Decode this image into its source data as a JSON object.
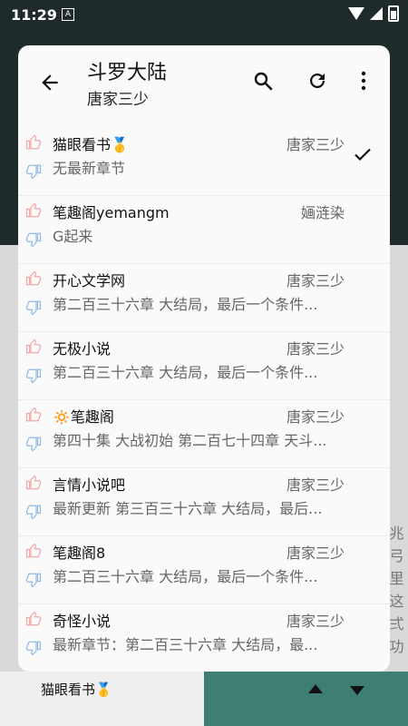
{
  "status_bar": {
    "time": "11:29",
    "notification": "A"
  },
  "header": {
    "title": "斗罗大陆",
    "subtitle": "唐家三少",
    "icons": {
      "back": "back-arrow-icon",
      "search": "search-icon",
      "refresh": "refresh-icon",
      "more": "more-vert-icon"
    }
  },
  "sources": [
    {
      "name": "猫眼看书🥇",
      "author": "唐家三少",
      "latest": "无最新章节",
      "selected": true
    },
    {
      "name": "笔趣阁yemangm",
      "author": "婳涟染",
      "latest": "G起来",
      "selected": false
    },
    {
      "name": "开心文学网",
      "author": "唐家三少",
      "latest": "第二百三十六章 大结局，最后一个条件...",
      "selected": false
    },
    {
      "name": "无极小说",
      "author": "唐家三少",
      "latest": "第二百三十六章 大结局，最后一个条件...",
      "selected": false
    },
    {
      "name": "🔅笔趣阁",
      "author": "唐家三少",
      "latest": "第四十集 大战初始 第二百七十四章 天斗...",
      "selected": false
    },
    {
      "name": "言情小说吧",
      "author": "唐家三少",
      "latest": "最新更新 第三百三十六章 大结局，最后...",
      "selected": false
    },
    {
      "name": "笔趣阁8",
      "author": "唐家三少",
      "latest": "第二百三十六章 大结局，最后一个条件...",
      "selected": false
    },
    {
      "name": "奇怪小说",
      "author": "唐家三少",
      "latest": "最新章节：第二百三十六章 大结局，最...",
      "selected": false
    }
  ],
  "footer": {
    "current_source": "猫眼看书🥇"
  },
  "background": {
    "side_text": "兆\n弓\n里\n这\n弍\n功"
  },
  "colors": {
    "thumb_up": "#f2a5a5",
    "thumb_down": "#8fb9e6",
    "bg_teal": "#3f7f73"
  }
}
